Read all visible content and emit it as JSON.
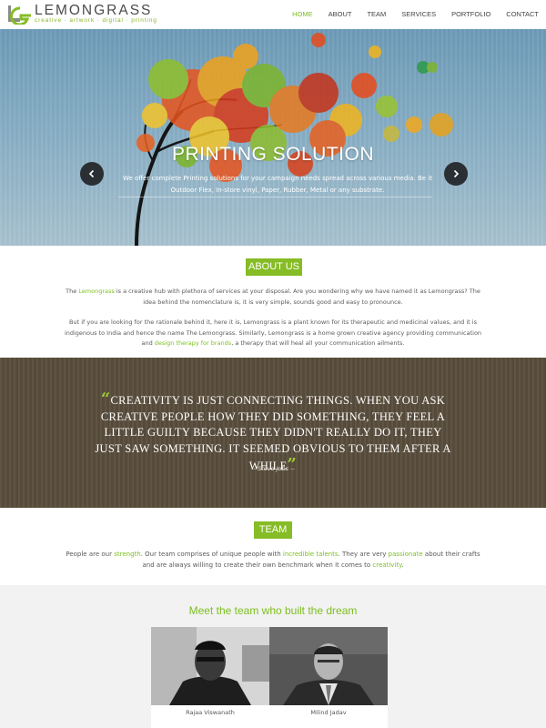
{
  "brand": {
    "name": "LEMONGRASS",
    "tagline": "creative · artwork · digital · printing",
    "accent_color": "#86bc25"
  },
  "nav": {
    "items": [
      {
        "label": "HOME",
        "active": true
      },
      {
        "label": "ABOUT",
        "active": false
      },
      {
        "label": "TEAM",
        "active": false
      },
      {
        "label": "SERVICES",
        "active": false
      },
      {
        "label": "PORTFOLIO",
        "active": false
      },
      {
        "label": "CONTACT",
        "active": false
      }
    ]
  },
  "hero": {
    "title": "PRINTING SOLUTION",
    "text": "We offer complete Printing solutions for your campaign needs spread across various media. Be it Outdoor Flex, In-store vinyl, Paper, Rubber, Metal or any substrate.",
    "prev_icon": "chevron-left-icon",
    "next_icon": "chevron-right-icon"
  },
  "about": {
    "heading": "ABOUT US",
    "p1": {
      "before": "The ",
      "link": "Lemongrass",
      "after": " is a creative hub with plethora of services at your disposal. Are you wondering why we have named it as Lemongrass? The idea behind the nomenclature is, it is very simple, sounds good and easy to pronounce."
    },
    "p2": {
      "before": "But if you are looking for the rationale behind it, here it is, Lemongrass is a plant known for its therapeutic and medicinal values, and it is indigenous to India and hence the name The Lemongrass. Similarly, Lemongrass is a home grown creative agency providing communication and ",
      "link": "design therapy for brands",
      "after": ", a therapy that will heal all your communication ailments."
    }
  },
  "quote": {
    "text": "Creativity is just connecting things. When you ask creative people how they did something, they feel a little guilty because they didn't really do it, they just saw something. It seemed obvious to them after a while",
    "author": "-- Steve Jobs --"
  },
  "team": {
    "heading": "TEAM",
    "text_parts": [
      {
        "t": "People are our ",
        "hl": false
      },
      {
        "t": "strength",
        "hl": true
      },
      {
        "t": ". Our team comprises of unique people with ",
        "hl": false
      },
      {
        "t": "incredible talents",
        "hl": true
      },
      {
        "t": ". They are very ",
        "hl": false
      },
      {
        "t": "passionate",
        "hl": true
      },
      {
        "t": " about their crafts and are always willing to create their own benchmark when it comes to ",
        "hl": false
      },
      {
        "t": "creativity",
        "hl": true
      },
      {
        "t": ".",
        "hl": false
      }
    ],
    "meet_heading": "Meet the team who built the dream",
    "members": [
      {
        "name": "Rajaa Viswanath"
      },
      {
        "name": "Milind Jadav"
      }
    ]
  }
}
